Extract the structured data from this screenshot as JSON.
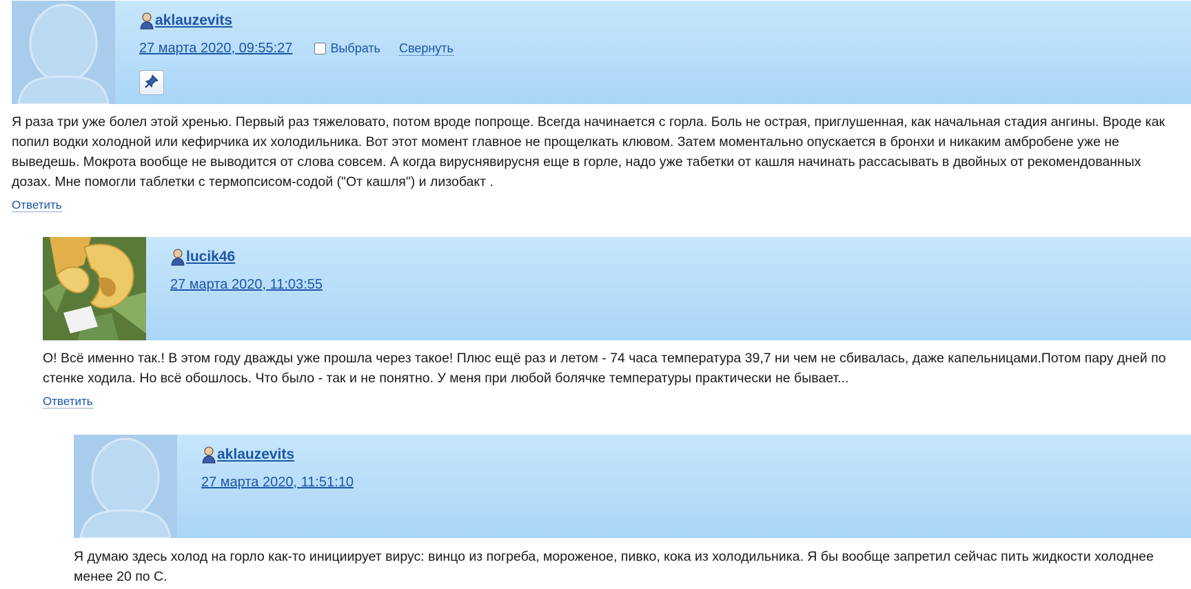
{
  "comments": [
    {
      "username": "aklauzevits",
      "date": "27 марта 2020, 09:55:27",
      "select_label": "Выбрать",
      "collapse_label": "Свернуть",
      "text": "Я раза три уже болел этой хренью. Первый раз тяжеловато, потом вроде попроще. Всегда начинается с горла. Боль не острая, приглушенная, как начальная стадия ангины. Вроде как попил водки холодной или кефирчика их холодильника. Вот этот момент главное не прощелкать клювом. Затем моментально опускается в бронхи и никаким амбробене уже не выведешь. Мокрота вообще не выводится от слова совсем. А когда вируснявирусня еще в горле, надо уже табетки от кашля начинать рассасывать в двойных от рекомендованных дозах. Мне помогли таблетки с термопсисом-содой (\"От кашля\") и лизобакт .",
      "reply_label": "Ответить"
    },
    {
      "username": "lucik46",
      "date": "27 марта 2020, 11:03:55",
      "text": "О! Всё именно так.! В этом году дважды уже прошла через такое! Плюс ещё раз и летом - 74 часа температура 39,7 ни чем не сбивалась, даже капельницами.Потом пару дней по стенке ходила. Но всё обошлось. Что было - так и не понятно. У меня при любой болячке температуры практически не бывает...",
      "reply_label": "Ответить"
    },
    {
      "username": "aklauzevits",
      "date": "27 марта 2020, 11:51:10",
      "text": "Я думаю здесь холод на горло как-то инициирует вирус: винцо из погреба, мороженое, пивко, кока из холодильника. Я бы вообще запретил сейчас пить жидкости холоднее менее 20 по С."
    }
  ],
  "icons": {
    "user": "user-icon",
    "pin": "pin-icon",
    "avatar_default": "default-avatar-icon",
    "avatar_photo": "melon-photo-avatar"
  },
  "colors": {
    "link": "#1d55a8",
    "header_bg": "#b7ddf9"
  }
}
